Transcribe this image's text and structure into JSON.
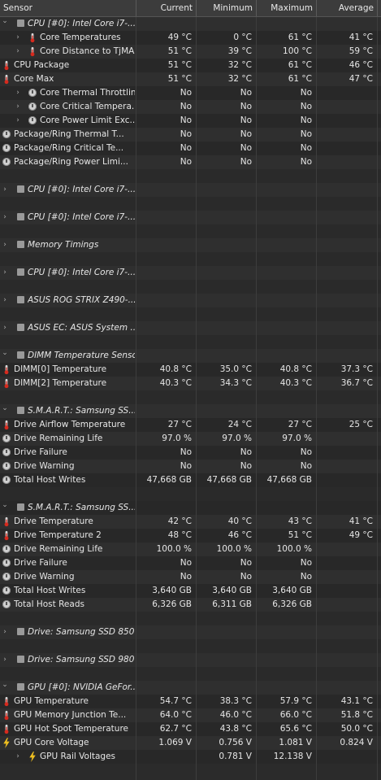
{
  "headers": {
    "sensor": "Sensor",
    "current": "Current",
    "minimum": "Minimum",
    "maximum": "Maximum",
    "average": "Average"
  },
  "rows": [
    {
      "type": "group",
      "level": 0,
      "expanded": true,
      "icon": "chip-icon",
      "name": "CPU [#0]: Intel Core i7-...",
      "cur": "",
      "min": "",
      "max": "",
      "avg": ""
    },
    {
      "type": "item",
      "level": 1,
      "expandable": true,
      "icon": "thermometer-icon",
      "name": "Core Temperatures",
      "cur": "49 °C",
      "min": "0 °C",
      "max": "61 °C",
      "avg": "41 °C"
    },
    {
      "type": "item",
      "level": 1,
      "expandable": true,
      "icon": "thermometer-icon",
      "name": "Core Distance to TjMAX",
      "cur": "51 °C",
      "min": "39 °C",
      "max": "100 °C",
      "avg": "59 °C"
    },
    {
      "type": "item",
      "level": 0,
      "icon": "thermometer-icon",
      "name": "CPU Package",
      "cur": "51 °C",
      "min": "32 °C",
      "max": "61 °C",
      "avg": "46 °C"
    },
    {
      "type": "item",
      "level": 0,
      "icon": "thermometer-icon",
      "name": "Core Max",
      "cur": "51 °C",
      "min": "32 °C",
      "max": "61 °C",
      "avg": "47 °C"
    },
    {
      "type": "item",
      "level": 1,
      "expandable": true,
      "icon": "clock-icon",
      "name": "Core Thermal Throttling",
      "cur": "No",
      "min": "No",
      "max": "No",
      "avg": ""
    },
    {
      "type": "item",
      "level": 1,
      "expandable": true,
      "icon": "clock-icon",
      "name": "Core Critical Tempera...",
      "cur": "No",
      "min": "No",
      "max": "No",
      "avg": ""
    },
    {
      "type": "item",
      "level": 1,
      "expandable": true,
      "icon": "clock-icon",
      "name": "Core Power Limit Exc...",
      "cur": "No",
      "min": "No",
      "max": "No",
      "avg": ""
    },
    {
      "type": "item",
      "level": 0,
      "icon": "clock-icon",
      "name": "Package/Ring Thermal T...",
      "cur": "No",
      "min": "No",
      "max": "No",
      "avg": ""
    },
    {
      "type": "item",
      "level": 0,
      "icon": "clock-icon",
      "name": "Package/Ring Critical Te...",
      "cur": "No",
      "min": "No",
      "max": "No",
      "avg": ""
    },
    {
      "type": "item",
      "level": 0,
      "icon": "clock-icon",
      "name": "Package/Ring Power Limi...",
      "cur": "No",
      "min": "No",
      "max": "No",
      "avg": ""
    },
    {
      "type": "gap"
    },
    {
      "type": "group",
      "level": 0,
      "expanded": false,
      "icon": "chip-icon",
      "name": "CPU [#0]: Intel Core i7-..."
    },
    {
      "type": "gap"
    },
    {
      "type": "group",
      "level": 0,
      "expanded": false,
      "icon": "chip-icon",
      "name": "CPU [#0]: Intel Core i7-..."
    },
    {
      "type": "gap"
    },
    {
      "type": "group",
      "level": 0,
      "expanded": false,
      "icon": "chip-icon",
      "name": "Memory Timings"
    },
    {
      "type": "gap"
    },
    {
      "type": "group",
      "level": 0,
      "expanded": false,
      "icon": "chip-icon",
      "name": "CPU [#0]: Intel Core i7-..."
    },
    {
      "type": "gap"
    },
    {
      "type": "group",
      "level": 0,
      "expanded": false,
      "icon": "chip-icon",
      "name": "ASUS ROG STRIX Z490-..."
    },
    {
      "type": "gap"
    },
    {
      "type": "group",
      "level": 0,
      "expanded": false,
      "icon": "chip-icon",
      "name": "ASUS EC: ASUS System ..."
    },
    {
      "type": "gap"
    },
    {
      "type": "group",
      "level": 0,
      "expanded": true,
      "icon": "chip-icon",
      "name": "DIMM Temperature Sensor"
    },
    {
      "type": "item",
      "level": 0,
      "icon": "thermometer-icon",
      "name": "DIMM[0] Temperature",
      "cur": "40.8 °C",
      "min": "35.0 °C",
      "max": "40.8 °C",
      "avg": "37.3 °C"
    },
    {
      "type": "item",
      "level": 0,
      "icon": "thermometer-icon",
      "name": "DIMM[2] Temperature",
      "cur": "40.3 °C",
      "min": "34.3 °C",
      "max": "40.3 °C",
      "avg": "36.7 °C"
    },
    {
      "type": "gap"
    },
    {
      "type": "group",
      "level": 0,
      "expanded": true,
      "icon": "chip-icon",
      "name": "S.M.A.R.T.: Samsung SS..."
    },
    {
      "type": "item",
      "level": 0,
      "icon": "thermometer-icon",
      "name": "Drive Airflow Temperature",
      "cur": "27 °C",
      "min": "24 °C",
      "max": "27 °C",
      "avg": "25 °C"
    },
    {
      "type": "item",
      "level": 0,
      "icon": "clock-icon",
      "name": "Drive Remaining Life",
      "cur": "97.0 %",
      "min": "97.0 %",
      "max": "97.0 %",
      "avg": ""
    },
    {
      "type": "item",
      "level": 0,
      "icon": "clock-icon",
      "name": "Drive Failure",
      "cur": "No",
      "min": "No",
      "max": "No",
      "avg": ""
    },
    {
      "type": "item",
      "level": 0,
      "icon": "clock-icon",
      "name": "Drive Warning",
      "cur": "No",
      "min": "No",
      "max": "No",
      "avg": ""
    },
    {
      "type": "item",
      "level": 0,
      "icon": "clock-icon",
      "name": "Total Host Writes",
      "cur": "47,668 GB",
      "min": "47,668 GB",
      "max": "47,668 GB",
      "avg": ""
    },
    {
      "type": "gap"
    },
    {
      "type": "group",
      "level": 0,
      "expanded": true,
      "icon": "chip-icon",
      "name": "S.M.A.R.T.: Samsung SS..."
    },
    {
      "type": "item",
      "level": 0,
      "icon": "thermometer-icon",
      "name": "Drive Temperature",
      "cur": "42 °C",
      "min": "40 °C",
      "max": "43 °C",
      "avg": "41 °C"
    },
    {
      "type": "item",
      "level": 0,
      "icon": "thermometer-icon",
      "name": "Drive Temperature 2",
      "cur": "48 °C",
      "min": "46 °C",
      "max": "51 °C",
      "avg": "49 °C"
    },
    {
      "type": "item",
      "level": 0,
      "icon": "clock-icon",
      "name": "Drive Remaining Life",
      "cur": "100.0 %",
      "min": "100.0 %",
      "max": "100.0 %",
      "avg": ""
    },
    {
      "type": "item",
      "level": 0,
      "icon": "clock-icon",
      "name": "Drive Failure",
      "cur": "No",
      "min": "No",
      "max": "No",
      "avg": ""
    },
    {
      "type": "item",
      "level": 0,
      "icon": "clock-icon",
      "name": "Drive Warning",
      "cur": "No",
      "min": "No",
      "max": "No",
      "avg": ""
    },
    {
      "type": "item",
      "level": 0,
      "icon": "clock-icon",
      "name": "Total Host Writes",
      "cur": "3,640 GB",
      "min": "3,640 GB",
      "max": "3,640 GB",
      "avg": ""
    },
    {
      "type": "item",
      "level": 0,
      "icon": "clock-icon",
      "name": "Total Host Reads",
      "cur": "6,326 GB",
      "min": "6,311 GB",
      "max": "6,326 GB",
      "avg": ""
    },
    {
      "type": "gap"
    },
    {
      "type": "group",
      "level": 0,
      "expanded": false,
      "icon": "chip-icon",
      "name": "Drive: Samsung SSD 850..."
    },
    {
      "type": "gap"
    },
    {
      "type": "group",
      "level": 0,
      "expanded": false,
      "icon": "chip-icon",
      "name": "Drive: Samsung SSD 980..."
    },
    {
      "type": "gap"
    },
    {
      "type": "group",
      "level": 0,
      "expanded": true,
      "icon": "chip-icon",
      "name": "GPU [#0]: NVIDIA GeFor..."
    },
    {
      "type": "item",
      "level": 0,
      "icon": "thermometer-icon",
      "name": "GPU Temperature",
      "cur": "54.7 °C",
      "min": "38.3 °C",
      "max": "57.9 °C",
      "avg": "43.1 °C"
    },
    {
      "type": "item",
      "level": 0,
      "icon": "thermometer-icon",
      "name": "GPU Memory Junction Te...",
      "cur": "64.0 °C",
      "min": "46.0 °C",
      "max": "66.0 °C",
      "avg": "51.8 °C"
    },
    {
      "type": "item",
      "level": 0,
      "icon": "thermometer-icon",
      "name": "GPU Hot Spot Temperature",
      "cur": "62.7 °C",
      "min": "43.8 °C",
      "max": "65.6 °C",
      "avg": "50.0 °C"
    },
    {
      "type": "item",
      "level": 0,
      "icon": "lightning-icon",
      "name": "GPU Core Voltage",
      "cur": "1.069 V",
      "min": "0.756 V",
      "max": "1.081 V",
      "avg": "0.824 V"
    },
    {
      "type": "item",
      "level": 1,
      "expandable": true,
      "icon": "lightning-icon",
      "name": "GPU Rail Voltages",
      "cur": "",
      "min": "0.781 V",
      "max": "12.138 V",
      "avg": ""
    }
  ]
}
